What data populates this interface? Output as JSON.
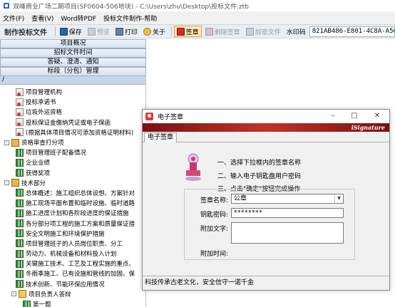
{
  "window": {
    "title": "双峰商业广场二期项目(SF0604-506地块) - C:\\Users\\zhu\\Desktop\\投标文件.ztb"
  },
  "menu": [
    "文件(F)",
    "查看(V)",
    "Word转PDF",
    "投标文件制作-帮助"
  ],
  "toolbar": {
    "title": "制作投标文件",
    "save": "保存",
    "preview": "预览",
    "print": "打印",
    "about": "关于",
    "sign": "签章",
    "delete_sign": "删除签章",
    "encrypt": "加密文件",
    "watermark_label": "水印码",
    "watermark_value": "821AB486-E801-4C8A-A568-6A"
  },
  "sections": [
    "项目概况",
    "招标文件时间",
    "答疑、澄清、通知",
    "标段（分包）管理"
  ],
  "path": "/",
  "tree": [
    {
      "label": "项目管理机构",
      "indent": 2,
      "icon": "doc"
    },
    {
      "label": "投标承诺书",
      "indent": 2,
      "icon": "doc"
    },
    {
      "label": "垃圾外运资格",
      "indent": 2,
      "icon": "doc"
    },
    {
      "label": "投标保证金缴纳凭证或电子保函",
      "indent": 2,
      "icon": "doc"
    },
    {
      "label": "(根据具体项目情况可添加资格证明材料)",
      "indent": 2,
      "icon": "doc"
    },
    {
      "label": "资格审查打分项",
      "indent": 0,
      "icon": "house",
      "exp": "-"
    },
    {
      "label": "项目管理班子配备情况",
      "indent": 2,
      "icon": "grid"
    },
    {
      "label": "企业业绩",
      "indent": 2,
      "icon": "grid"
    },
    {
      "label": "获得奖项",
      "indent": 2,
      "icon": "grid"
    },
    {
      "label": "技术部分",
      "indent": 0,
      "icon": "house",
      "exp": "-"
    },
    {
      "label": "总体概述：施工组织总体设想、方案针对",
      "indent": 2,
      "icon": "grid"
    },
    {
      "label": "施工现场平面布置和临时设施、临时道路",
      "indent": 2,
      "icon": "grid"
    },
    {
      "label": "施工进度计划和各阶段进度的保证措施",
      "indent": 2,
      "icon": "grid"
    },
    {
      "label": "各分部分项工程的施工方案和质量保证措",
      "indent": 2,
      "icon": "grid"
    },
    {
      "label": "安全文明施工和环境保护措施",
      "indent": 2,
      "icon": "grid"
    },
    {
      "label": "项目管理班子的人员岗位职责、分工",
      "indent": 2,
      "icon": "grid"
    },
    {
      "label": "劳动力、机械设备和材料投入计划",
      "indent": 2,
      "icon": "grid"
    },
    {
      "label": "关键施工技术、工艺及工程实施的重点、",
      "indent": 2,
      "icon": "grid"
    },
    {
      "label": "冬雨季施工、已有设施和管线的加固、保",
      "indent": 2,
      "icon": "grid"
    },
    {
      "label": "技术创新、节能环保应用情况",
      "indent": 2,
      "icon": "grid"
    },
    {
      "label": "项目负责人答辩",
      "indent": 1,
      "icon": "folder",
      "exp": "-"
    },
    {
      "label": "第一题",
      "indent": 3,
      "icon": "grid"
    },
    {
      "label": "第二题",
      "indent": 3,
      "icon": "grid"
    }
  ],
  "dialog": {
    "title": "电子签章",
    "brand": "iSignature",
    "tab": "电子签章",
    "steps": [
      "一、选择下拉框内的签章名称",
      "二、输入电子钥匙盘用户密码",
      "三、点击\"确定\"按钮完成操作"
    ],
    "sign_name_label": "签章名称:",
    "sign_name_value": "公章",
    "password_label": "钥匙密码:",
    "password_value": "********",
    "extra_text_label": "附加文字:",
    "extra_time_label": "附加时间:",
    "status": "科技传承古老文化，安全信守一诺千金"
  }
}
